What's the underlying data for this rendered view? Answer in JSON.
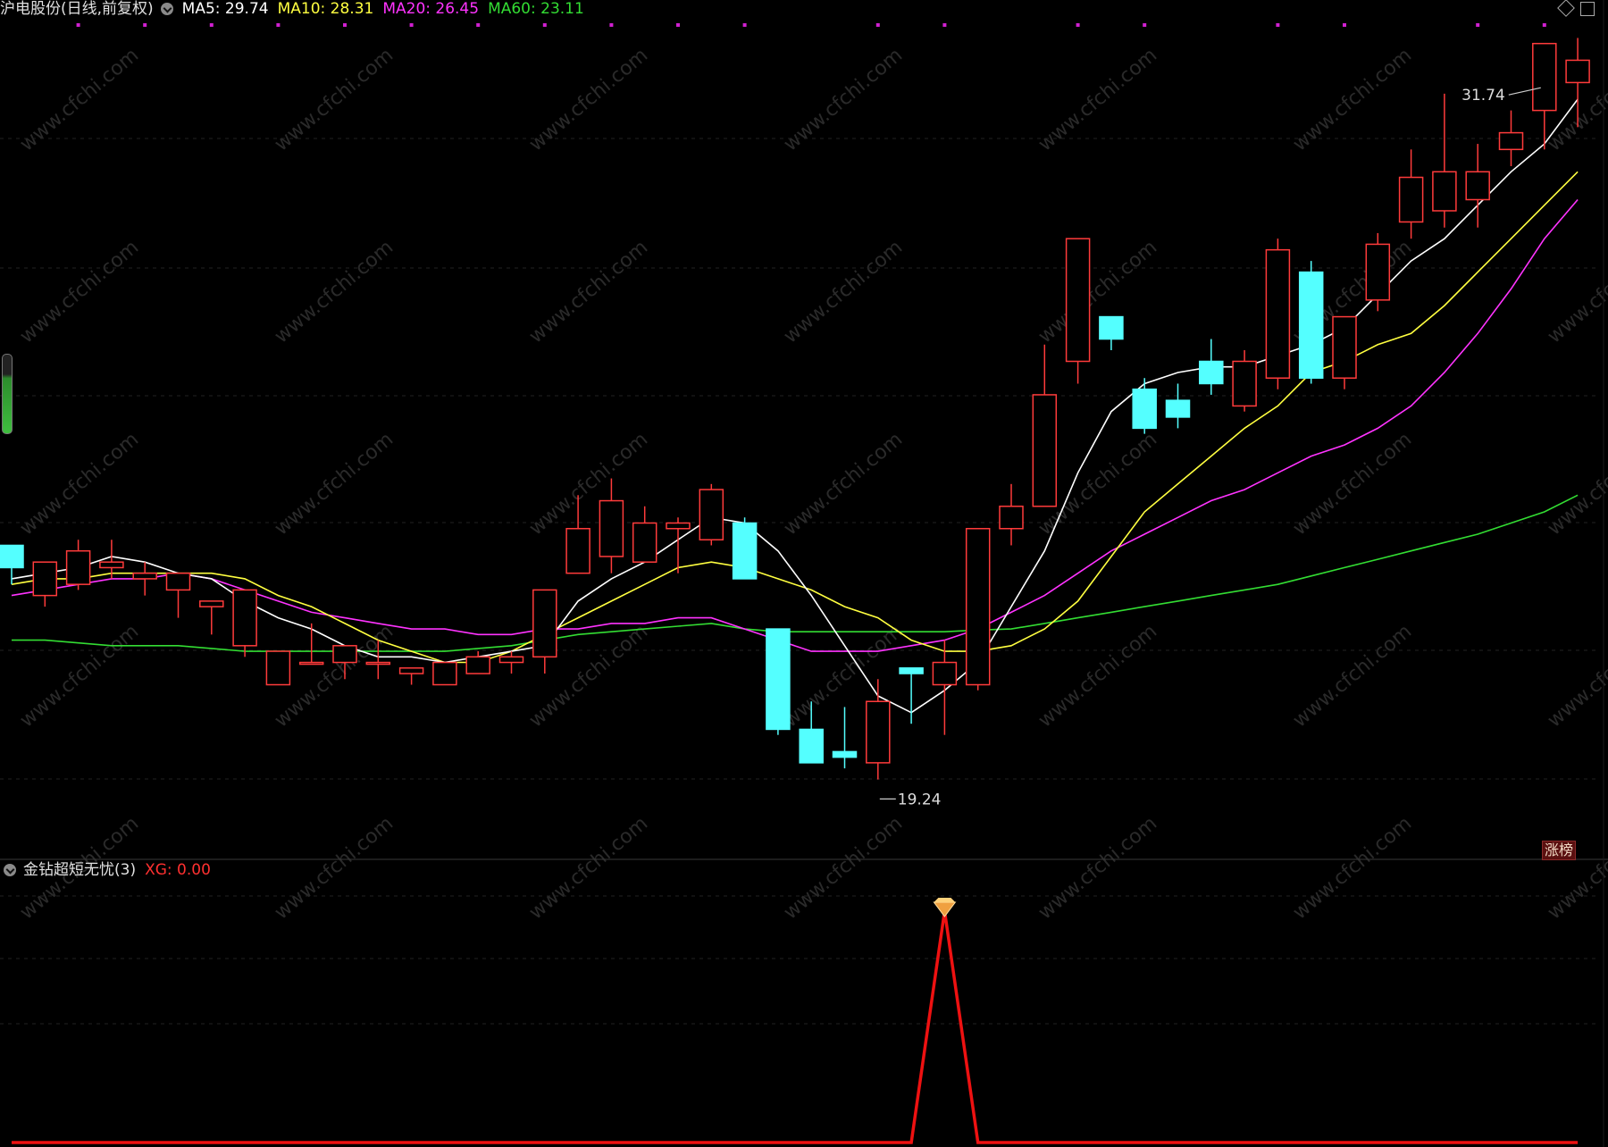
{
  "chart_data": [
    {
      "type": "candlestick",
      "title": "沪电股份(日线,前复权)",
      "ma_legend": [
        {
          "label": "MA5: 29.74",
          "color": "#ffffff"
        },
        {
          "label": "MA10: 28.31",
          "color": "#ffff40"
        },
        {
          "label": "MA20: 26.45",
          "color": "#ff33ff"
        },
        {
          "label": "MA60: 23.11",
          "color": "#33dd33"
        }
      ],
      "ylim": [
        17.9,
        32.8
      ],
      "grid": true,
      "up_color": "#ff3b3b",
      "down_color": "#54ffff",
      "annotations": [
        {
          "text": "31.74",
          "candle": 46,
          "value": 31.74,
          "side": "left"
        },
        {
          "text": "19.24",
          "candle": 26,
          "value": 19.24,
          "side": "right"
        }
      ],
      "candles": [
        [
          23.5,
          23.1,
          23.5,
          22.8
        ],
        [
          22.6,
          23.2,
          23.2,
          22.4
        ],
        [
          22.8,
          23.4,
          23.6,
          22.7
        ],
        [
          23.1,
          23.2,
          23.6,
          22.9
        ],
        [
          22.9,
          23.0,
          23.2,
          22.6
        ],
        [
          22.7,
          23.0,
          23.0,
          22.2
        ],
        [
          22.4,
          22.5,
          22.5,
          21.9
        ],
        [
          21.7,
          22.7,
          22.7,
          21.5
        ],
        [
          21.0,
          21.6,
          21.6,
          21.0
        ],
        [
          21.4,
          21.4,
          22.1,
          21.4
        ],
        [
          21.4,
          21.7,
          21.7,
          21.1
        ],
        [
          21.4,
          21.4,
          21.8,
          21.1
        ],
        [
          21.2,
          21.3,
          21.3,
          21.0
        ],
        [
          21.0,
          21.4,
          21.4,
          21.0
        ],
        [
          21.2,
          21.5,
          21.6,
          21.2
        ],
        [
          21.4,
          21.5,
          21.6,
          21.2
        ],
        [
          21.5,
          22.7,
          22.7,
          21.2
        ],
        [
          23.0,
          23.8,
          24.4,
          23.0
        ],
        [
          23.3,
          24.3,
          24.7,
          23.0
        ],
        [
          23.2,
          23.9,
          24.2,
          23.2
        ],
        [
          23.8,
          23.9,
          24.0,
          23.0
        ],
        [
          23.6,
          24.5,
          24.6,
          23.5
        ],
        [
          23.9,
          22.9,
          24.0,
          22.9
        ],
        [
          22.0,
          20.2,
          22.0,
          20.1
        ],
        [
          20.2,
          19.6,
          20.7,
          19.6
        ],
        [
          19.8,
          19.7,
          20.6,
          19.5
        ],
        [
          19.6,
          20.7,
          21.1,
          19.3
        ],
        [
          21.3,
          21.2,
          21.3,
          20.3
        ],
        [
          21.0,
          21.4,
          21.8,
          20.1
        ],
        [
          21.0,
          23.8,
          23.8,
          20.9
        ],
        [
          23.8,
          24.2,
          24.6,
          23.5
        ],
        [
          24.2,
          26.2,
          27.1,
          24.2
        ],
        [
          26.8,
          29.0,
          29.0,
          26.4
        ],
        [
          27.6,
          27.2,
          27.6,
          27.0
        ],
        [
          26.3,
          25.6,
          26.5,
          25.5
        ],
        [
          26.1,
          25.8,
          26.4,
          25.6
        ],
        [
          26.8,
          26.4,
          27.2,
          26.2
        ],
        [
          26.0,
          26.8,
          27.0,
          25.9
        ],
        [
          26.5,
          28.8,
          29.0,
          26.3
        ],
        [
          28.4,
          26.5,
          28.6,
          26.4
        ],
        [
          26.5,
          27.6,
          27.6,
          26.3
        ],
        [
          27.9,
          28.9,
          29.1,
          27.7
        ],
        [
          29.3,
          30.1,
          30.6,
          29.0
        ],
        [
          29.5,
          30.2,
          31.6,
          29.2
        ],
        [
          29.7,
          30.2,
          30.7,
          29.2
        ],
        [
          30.6,
          30.9,
          31.3,
          30.3
        ],
        [
          31.3,
          32.5,
          32.5,
          30.6
        ],
        [
          31.8,
          32.2,
          32.6,
          31.0
        ]
      ],
      "ma5": [
        22.9,
        23.0,
        23.1,
        23.3,
        23.2,
        23.0,
        22.9,
        22.5,
        22.2,
        22.0,
        21.7,
        21.5,
        21.5,
        21.4,
        21.5,
        21.6,
        21.7,
        22.5,
        22.9,
        23.2,
        23.6,
        24.0,
        23.9,
        23.4,
        22.6,
        21.7,
        20.8,
        20.5,
        20.9,
        21.4,
        22.4,
        23.4,
        24.8,
        25.9,
        26.4,
        26.6,
        26.7,
        26.7,
        26.9,
        27.1,
        27.4,
        28.0,
        28.6,
        29.0,
        29.6,
        30.2,
        30.7,
        31.5
      ],
      "ma10": [
        22.8,
        22.9,
        22.9,
        23.0,
        23.0,
        23.0,
        23.0,
        22.9,
        22.6,
        22.4,
        22.1,
        21.8,
        21.6,
        21.4,
        21.4,
        21.6,
        21.9,
        22.2,
        22.5,
        22.8,
        23.1,
        23.2,
        23.1,
        22.9,
        22.7,
        22.4,
        22.2,
        21.8,
        21.6,
        21.6,
        21.7,
        22.0,
        22.5,
        23.3,
        24.1,
        24.6,
        25.1,
        25.6,
        26.0,
        26.6,
        26.8,
        27.1,
        27.3,
        27.8,
        28.4,
        29.0,
        29.6,
        30.2
      ],
      "ma20": [
        22.6,
        22.7,
        22.8,
        22.9,
        22.9,
        23.0,
        22.9,
        22.7,
        22.5,
        22.3,
        22.2,
        22.1,
        22.0,
        22.0,
        21.9,
        21.9,
        22.0,
        22.0,
        22.1,
        22.1,
        22.2,
        22.2,
        22.0,
        21.8,
        21.6,
        21.6,
        21.6,
        21.7,
        21.8,
        22.0,
        22.3,
        22.6,
        23.0,
        23.4,
        23.7,
        24.0,
        24.3,
        24.5,
        24.8,
        25.1,
        25.3,
        25.6,
        26.0,
        26.6,
        27.3,
        28.1,
        29.0,
        29.7
      ],
      "ma60": [
        21.8,
        21.8,
        21.75,
        21.7,
        21.7,
        21.7,
        21.65,
        21.6,
        21.6,
        21.6,
        21.6,
        21.6,
        21.6,
        21.6,
        21.65,
        21.7,
        21.8,
        21.9,
        21.95,
        22.0,
        22.05,
        22.1,
        22.0,
        21.95,
        21.95,
        21.95,
        21.95,
        21.95,
        21.95,
        21.98,
        22.0,
        22.1,
        22.2,
        22.3,
        22.4,
        22.5,
        22.6,
        22.7,
        22.8,
        22.95,
        23.1,
        23.25,
        23.4,
        23.55,
        23.7,
        23.9,
        24.1,
        24.4
      ]
    },
    {
      "type": "line",
      "title": "金钻超短无忧(3)",
      "xg_label": "XG: 0.00",
      "color": "#ee1111",
      "ylim": [
        0,
        1
      ],
      "values": [
        0,
        0,
        0,
        0,
        0,
        0,
        0,
        0,
        0,
        0,
        0,
        0,
        0,
        0,
        0,
        0,
        0,
        0,
        0,
        0,
        0,
        0,
        0,
        0,
        0,
        0,
        0,
        0,
        1,
        0,
        0,
        0,
        0,
        0,
        0,
        0,
        0,
        0,
        0,
        0,
        0,
        0,
        0,
        0,
        0,
        0,
        0,
        0
      ]
    }
  ],
  "watermark": "www.cfchi.com",
  "badge": "涨榜"
}
